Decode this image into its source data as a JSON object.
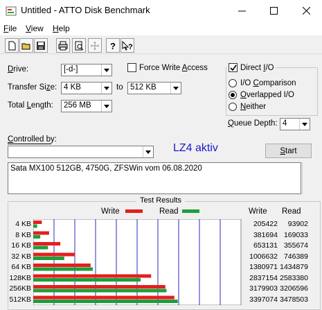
{
  "window": {
    "title": "Untitled - ATTO Disk Benchmark",
    "minimize_icon": "minimize-icon",
    "maximize_icon": "maximize-icon",
    "close_icon": "close-icon"
  },
  "menu": {
    "items": [
      {
        "label": "File",
        "key": "F",
        "rest": "ile"
      },
      {
        "label": "View",
        "key": "V",
        "rest": "iew"
      },
      {
        "label": "Help",
        "key": "H",
        "rest": "elp"
      }
    ]
  },
  "toolbar": {
    "buttons": [
      "new-icon",
      "open-icon",
      "save-icon",
      "print-icon",
      "print-preview-icon",
      "move-icon",
      "help-icon",
      "context-help-icon"
    ]
  },
  "form": {
    "drive_label_key": "D",
    "drive_label_rest": "rive:",
    "drive_value": "[-d-]",
    "transfer_label_a": "Transfer Si",
    "transfer_label_key": "z",
    "transfer_label_b": "e:",
    "transfer_from": "4 KB",
    "transfer_to_label": "to",
    "transfer_to": "512 KB",
    "total_label_a": "Total ",
    "total_label_key": "L",
    "total_label_b": "ength:",
    "total_value": "256 MB",
    "force_write_a": "Force Write ",
    "force_write_key": "A",
    "force_write_b": "ccess",
    "force_write_checked": false,
    "direct_io_a": "Direct ",
    "direct_io_key": "I",
    "direct_io_b": "/O",
    "direct_io_checked": true,
    "io_comparison_a": "I/O ",
    "io_comparison_key": "C",
    "io_comparison_b": "omparison",
    "overlapped_key": "O",
    "overlapped_rest": "verlapped I/O",
    "neither_key": "N",
    "neither_rest": "either",
    "selected_mode": "overlapped",
    "queue_label_a": "",
    "queue_label_key": "Q",
    "queue_label_b": "ueue Depth:",
    "queue_value": "4",
    "controlled_label_a": "",
    "controlled_label_key": "C",
    "controlled_label_b": "ontrolled by:",
    "controlled_value": "",
    "annotation": "LZ4 aktiv",
    "annotation_color": "#1a1acd",
    "start_key": "S",
    "start_rest": "tart",
    "description": "Sata MX100 512GB, 4750G, ZFSWin vom 06.08.2020"
  },
  "results": {
    "title": "Test Results",
    "write_label": "Write",
    "read_label": "Read",
    "write_color": "#e41e1e",
    "read_color": "#1e9e3a",
    "col_write": "Write",
    "col_read": "Read",
    "rows": [
      {
        "label": "4 KB",
        "write": "205422",
        "read": "93902"
      },
      {
        "label": "8 KB",
        "write": "381694",
        "read": "169033"
      },
      {
        "label": "16 KB",
        "write": "653131",
        "read": "355674"
      },
      {
        "label": "32 KB",
        "write": "1006632",
        "read": "746389"
      },
      {
        "label": "64 KB",
        "write": "1380971",
        "read": "1434879"
      },
      {
        "label": "128KB",
        "write": "2837154",
        "read": "2583380"
      },
      {
        "label": "256KB",
        "write": "3179903",
        "read": "3206596"
      },
      {
        "label": "512KB",
        "write": "3397074",
        "read": "3478503"
      }
    ]
  },
  "chart_data": {
    "type": "bar",
    "orientation": "horizontal",
    "categories": [
      "4 KB",
      "8 KB",
      "16 KB",
      "32 KB",
      "64 KB",
      "128KB",
      "256KB",
      "512KB"
    ],
    "series": [
      {
        "name": "Write",
        "values": [
          205422,
          381694,
          653131,
          1006632,
          1380971,
          2837154,
          3179903,
          3397074
        ]
      },
      {
        "name": "Read",
        "values": [
          93902,
          169033,
          355674,
          746389,
          1434879,
          2583380,
          3206596,
          3478503
        ]
      }
    ],
    "xlim": [
      0,
      5000000
    ],
    "grid": true
  }
}
